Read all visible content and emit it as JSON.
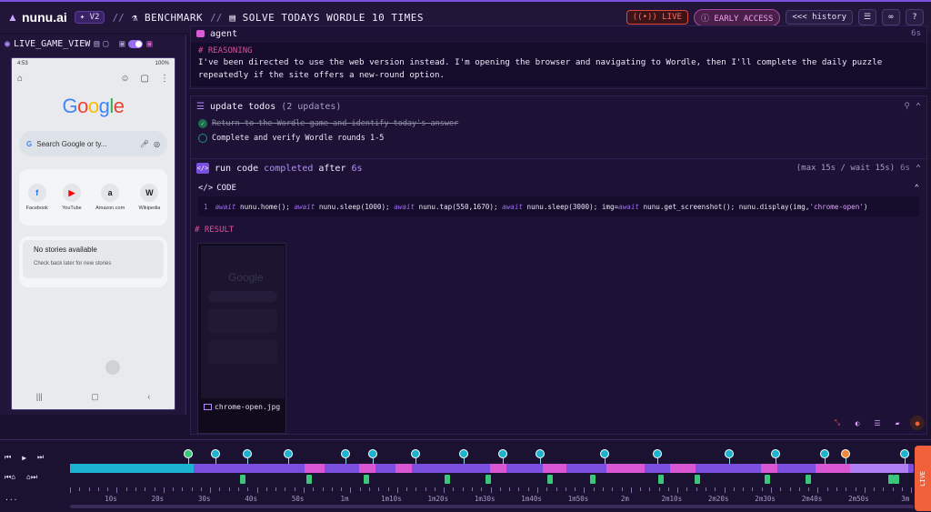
{
  "header": {
    "logo": "nunu.ai",
    "version": "V2",
    "crumbs": [
      "BENCHMARK",
      "SOLVE TODAYS WORDLE 10 TIMES"
    ],
    "live": "LIVE",
    "early_access": "EARLY ACCESS",
    "history": "<<< history",
    "help": "?"
  },
  "left_panel": {
    "title": "LIVE_GAME_VIEW",
    "phone": {
      "status_left": "4:53",
      "status_right": "100%",
      "google": [
        "G",
        "o",
        "o",
        "g",
        "l",
        "e"
      ],
      "search_placeholder": "Search Google or ty...",
      "shortcuts": [
        {
          "label": "Facebook",
          "glyph": "f"
        },
        {
          "label": "YouTube",
          "glyph": "▶"
        },
        {
          "label": "Amazon.com",
          "glyph": "a"
        },
        {
          "label": "Wikipedia",
          "glyph": "W"
        }
      ],
      "stories_title": "No stories available",
      "stories_sub": "Check back later for new stories"
    }
  },
  "agent": {
    "label": "agent",
    "time": "6s",
    "reasoning_header": "# REASONING",
    "reasoning_text": "I've been directed to use the web version instead. I'm opening the browser and navigating to Wordle, then I'll complete the daily puzzle repeatedly if the site offers a new-round option."
  },
  "todos": {
    "label": "update todos",
    "count": "(2 updates)",
    "items": [
      {
        "text": "Return to the Wordle game and identify today's answer",
        "done": true
      },
      {
        "text": "Complete and verify Wordle rounds 1-5",
        "done": false
      }
    ]
  },
  "run_code": {
    "run": "run code",
    "status": "completed",
    "after": "after",
    "secs": "6s",
    "limits": "(max 15s / wait 15s)",
    "time": "6s",
    "code_header": "CODE",
    "line_no": "1",
    "result_header": "# RESULT",
    "thumb_caption": "chrome-open.jpg"
  },
  "timeline": {
    "labels": [
      "10s",
      "20s",
      "30s",
      "40s",
      "50s",
      "1m",
      "1m10s",
      "1m20s",
      "1m30s",
      "1m40s",
      "1m50s",
      "2m",
      "2m10s",
      "2m20s",
      "2m30s",
      "2m40s",
      "2m50s",
      "3m"
    ],
    "live_tab": "LIVE",
    "more": "..."
  }
}
